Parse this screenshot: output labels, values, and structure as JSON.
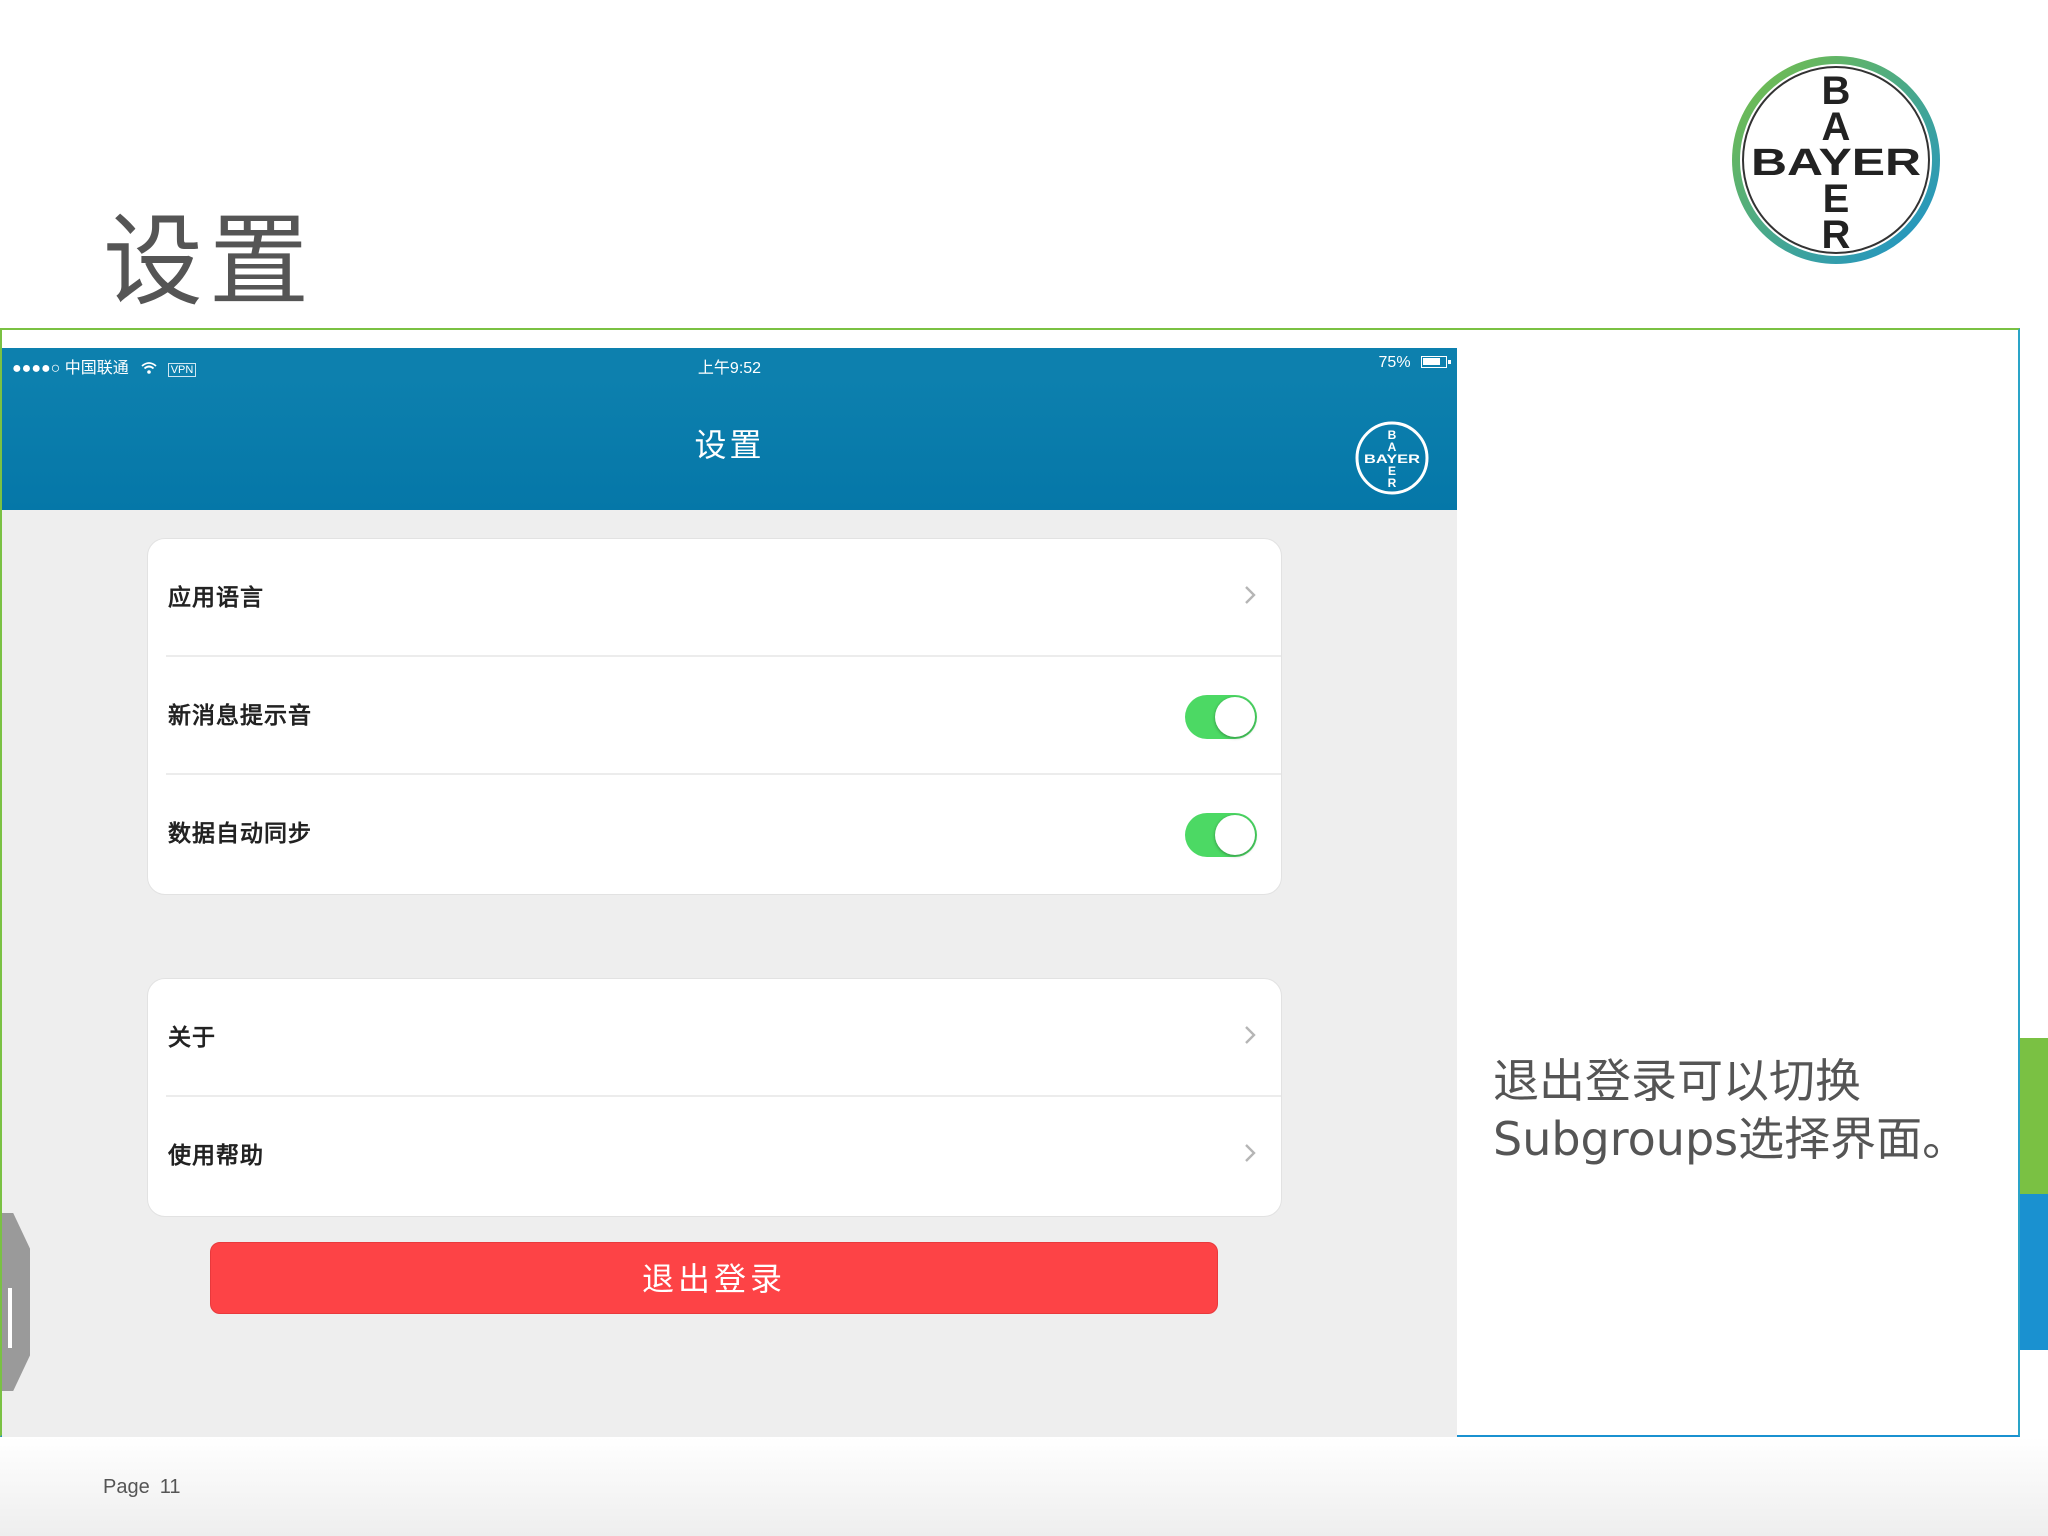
{
  "slide": {
    "title": "设置",
    "page_prefix": "Page",
    "page_number": "11",
    "callout_line1": "退出登录可以切换",
    "callout_line2": "Subgroups选择界面。"
  },
  "logo": {
    "vertical_letters": [
      "B",
      "A",
      "E",
      "R"
    ],
    "horizontal_word": "BAYER"
  },
  "status_bar": {
    "carrier": "●●●●○ 中国联通",
    "wifi_icon": "wifi-icon",
    "vpn": "VPN",
    "time": "上午9:52",
    "battery": "75%"
  },
  "nav": {
    "title": "设置"
  },
  "settings_group_1": [
    {
      "label": "应用语言",
      "control": "chevron"
    },
    {
      "label": "新消息提示音",
      "control": "toggle",
      "on": true
    },
    {
      "label": "数据自动同步",
      "control": "toggle",
      "on": true
    }
  ],
  "settings_group_2": [
    {
      "label": "关于",
      "control": "chevron"
    },
    {
      "label": "使用帮助",
      "control": "chevron"
    }
  ],
  "logout_button": "退出登录",
  "colors": {
    "nav_blue": "#0d80ae",
    "toggle_green": "#4cd964",
    "logout_red": "#fd4346",
    "bayer_green": "#7ac143",
    "bayer_blue": "#1a91d0"
  }
}
